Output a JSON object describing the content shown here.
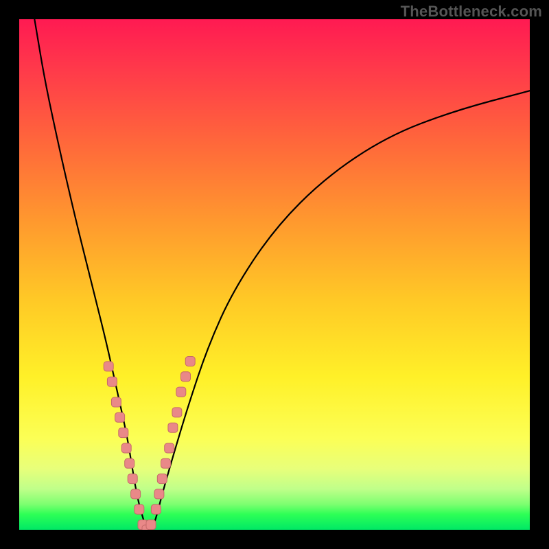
{
  "watermark": "TheBottleneck.com",
  "colors": {
    "frame": "#000000",
    "curve": "#000000",
    "marker_fill": "#e98888",
    "marker_stroke": "#c56a6a",
    "gradient_stops": [
      "#ff1a52",
      "#ff6a3a",
      "#ffc926",
      "#fff028",
      "#7dff70",
      "#00e865"
    ]
  },
  "chart_data": {
    "type": "line",
    "title": "",
    "xlabel": "",
    "ylabel": "",
    "xlim": [
      0,
      100
    ],
    "ylim": [
      0,
      100
    ],
    "curve": {
      "description": "V-shaped bottleneck curve; minimum near x≈25, bottleneck=0; rises steeply on both sides",
      "x": [
        3,
        5,
        8,
        11,
        14,
        17,
        19,
        21,
        22,
        23,
        24,
        25,
        26,
        27,
        28,
        30,
        33,
        37,
        42,
        50,
        60,
        72,
        85,
        100
      ],
      "y": [
        100,
        88,
        74,
        61,
        49,
        37,
        28,
        19,
        13,
        7,
        3,
        0,
        0,
        3,
        7,
        14,
        24,
        36,
        47,
        59,
        69,
        77,
        82,
        86
      ]
    },
    "series": [
      {
        "name": "left-branch-markers",
        "x": [
          17.5,
          18.2,
          19.0,
          19.7,
          20.4,
          21.0,
          21.6,
          22.2,
          22.8,
          23.5
        ],
        "y": [
          32,
          29,
          25,
          22,
          19,
          16,
          13,
          10,
          7,
          4
        ]
      },
      {
        "name": "right-branch-markers",
        "x": [
          26.8,
          27.4,
          28.0,
          28.7,
          29.4,
          30.1,
          30.9,
          31.7,
          32.6,
          33.5
        ],
        "y": [
          4,
          7,
          10,
          13,
          16,
          20,
          23,
          27,
          30,
          33
        ]
      },
      {
        "name": "bottom-markers",
        "x": [
          24.2,
          25.0,
          25.8
        ],
        "y": [
          1,
          0,
          1
        ]
      }
    ]
  }
}
